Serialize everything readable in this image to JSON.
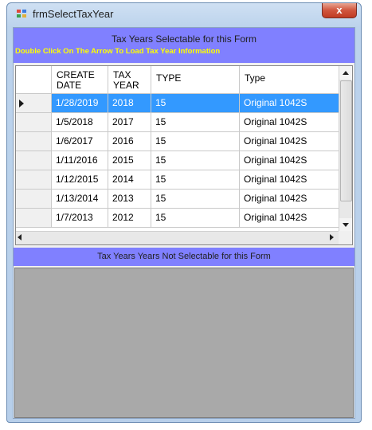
{
  "window": {
    "title": "frmSelectTaxYear",
    "close_label": "x"
  },
  "selectable_header": {
    "title": "Tax Years Selectable for this Form",
    "hint": "Double Click On The Arrow To Load Tax Year Information"
  },
  "grid": {
    "columns": [
      "CREATE\nDATE",
      "TAX\nYEAR",
      "TYPE",
      "Type"
    ],
    "rows": [
      {
        "create_date": "1/28/2019",
        "tax_year": "2018",
        "type": "15",
        "type_desc": "Original 1042S",
        "selected": true
      },
      {
        "create_date": "1/5/2018",
        "tax_year": "2017",
        "type": "15",
        "type_desc": "Original 1042S"
      },
      {
        "create_date": "1/6/2017",
        "tax_year": "2016",
        "type": "15",
        "type_desc": "Original 1042S"
      },
      {
        "create_date": "1/11/2016",
        "tax_year": "2015",
        "type": "15",
        "type_desc": "Original 1042S"
      },
      {
        "create_date": "1/12/2015",
        "tax_year": "2014",
        "type": "15",
        "type_desc": "Original 1042S"
      },
      {
        "create_date": "1/13/2014",
        "tax_year": "2013",
        "type": "15",
        "type_desc": "Original 1042S"
      },
      {
        "create_date": "1/7/2013",
        "tax_year": "2012",
        "type": "15",
        "type_desc": "Original 1042S"
      }
    ]
  },
  "non_selectable_header": {
    "title": "Tax Years Years Not Selectable for this Form"
  },
  "colors": {
    "header_band": "#8080ff",
    "hint_text": "#ffff00",
    "selection": "#3399ff",
    "empty_panel": "#a9a9a9"
  }
}
